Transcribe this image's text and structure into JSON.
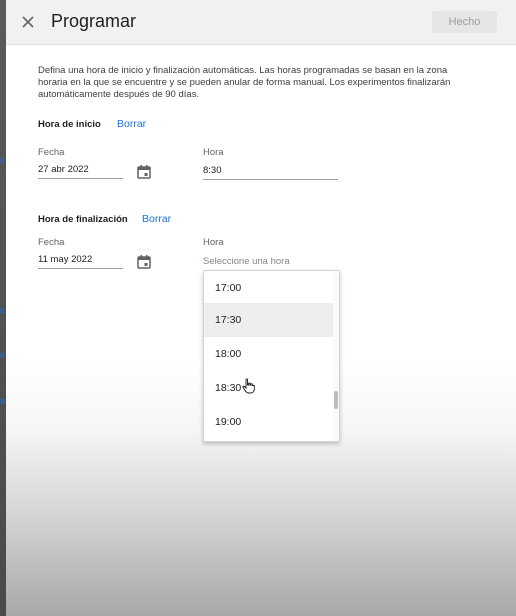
{
  "dialog": {
    "title": "Programar",
    "done_label": "Hecho",
    "description": "Defina una hora de inicio y finalización automáticas. Las horas programadas se basan en la zona horaria en la que se encuentre y se pueden anular de forma manual. Los experimentos finalizarán automáticamente después de 90 días."
  },
  "start": {
    "title": "Hora de inicio",
    "clear_label": "Borrar",
    "date_label": "Fecha",
    "date_value": "27 abr 2022",
    "time_label": "Hora",
    "time_value": "8:30"
  },
  "end": {
    "title": "Hora de finalización",
    "clear_label": "Borrar",
    "date_label": "Fecha",
    "date_value": "11 may 2022",
    "time_label": "Hora",
    "time_placeholder": "Seleccione una hora"
  },
  "time_options": [
    "17:00",
    "17:30",
    "18:00",
    "18:30",
    "19:00"
  ],
  "colors": {
    "accent": "#1a73e8",
    "hover": "#eeeeee"
  },
  "icons": [
    "close-icon",
    "calendar-icon",
    "hand-pointer-icon"
  ]
}
